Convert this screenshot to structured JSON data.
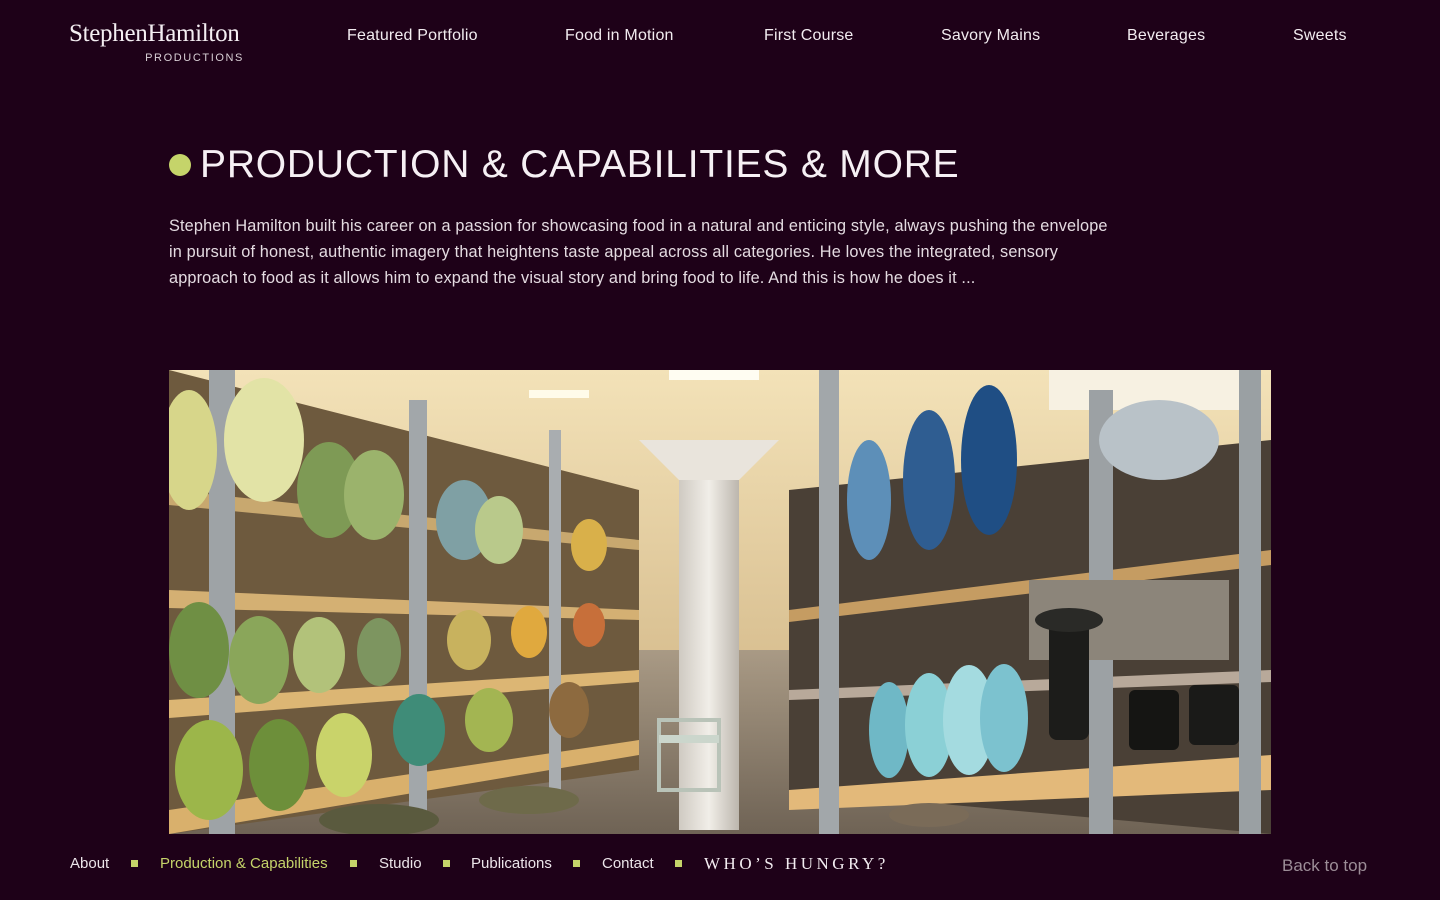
{
  "brand": {
    "name": "StephenHamilton",
    "subtitle": "PRODUCTIONS"
  },
  "nav": {
    "items": [
      {
        "label": "Featured Portfolio"
      },
      {
        "label": "Food in Motion"
      },
      {
        "label": "First Course"
      },
      {
        "label": "Savory Mains"
      },
      {
        "label": "Beverages"
      },
      {
        "label": "Sweets"
      }
    ]
  },
  "main": {
    "title": "PRODUCTION & CAPABILITIES & MORE",
    "intro": "Stephen Hamilton built his career on a passion for showcasing food in a natural and enticing style, always pushing the envelope in pursuit of honest, authentic imagery that heightens taste appeal across all categories. He loves the integrated, sensory approach to food as it allows him to expand the visual story and bring food to life. And this is how he does it ..."
  },
  "footer": {
    "links": [
      {
        "label": "About"
      },
      {
        "label": "Production & Capabilities",
        "active": true
      },
      {
        "label": "Studio"
      },
      {
        "label": "Publications"
      },
      {
        "label": "Contact"
      }
    ],
    "tagline": "WHO’S HUNGRY?",
    "back_to_top": "Back to top"
  },
  "colors": {
    "background": "#1e0118",
    "accent": "#c5d46a",
    "text": "#efe7ec",
    "muted": "#9c8d97"
  }
}
